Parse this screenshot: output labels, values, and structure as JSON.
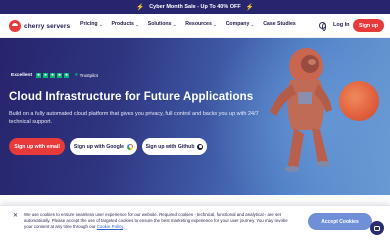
{
  "promo": {
    "text": "Cyber Month Sale - Up To 40% OFF",
    "bolt_glyph": "⚡"
  },
  "nav": {
    "logo_text": "cherry servers",
    "menu": [
      {
        "label": "Pricing",
        "has_dropdown": true
      },
      {
        "label": "Products",
        "has_dropdown": true
      },
      {
        "label": "Solutions",
        "has_dropdown": true
      },
      {
        "label": "Resources",
        "has_dropdown": true
      },
      {
        "label": "Company",
        "has_dropdown": true
      },
      {
        "label": "Case Studies",
        "has_dropdown": false
      }
    ],
    "chevron_glyph": "⌄",
    "login_label": "Log In",
    "signup_label": "Sign up"
  },
  "hero": {
    "trust_excellent": "Excellent",
    "trust_stars": [
      "★",
      "★",
      "★",
      "★",
      "★"
    ],
    "trust_brand": "Trustpilot",
    "trust_brand_icon": "★",
    "headline": "Cloud Infrastructure for Future Applications",
    "subtext": "Build on a fully automated cloud platform that gives you privacy, full control and backs you up with 24/7 technical support.",
    "buttons": {
      "email": "Sign up with email",
      "google": "Sign up with Google",
      "github": "Sign up with Github"
    }
  },
  "cookie": {
    "close_glyph": "✕",
    "text": "We use cookies to ensure seamless user experience for our website. Required cookies - technical, functional and analytical - are set automatically. Please accept the use of targeted cookies to ensure the best marketing experience for your user journey. You may revoke your consent at any time through our",
    "link": "Cookie Policy",
    "end": ".",
    "accept_label": "Accept Cookies"
  },
  "colors": {
    "brand_red": "#e93a3b",
    "navy": "#26256e",
    "trustpilot_green": "#00b67a",
    "accept_blue": "#6f8fd8"
  },
  "icons": [
    "lightning-icon",
    "cherry-logo-icon",
    "chevron-down-icon",
    "globe-icon",
    "trustpilot-star-icon",
    "google-icon",
    "github-icon",
    "close-icon",
    "chat-icon"
  ]
}
